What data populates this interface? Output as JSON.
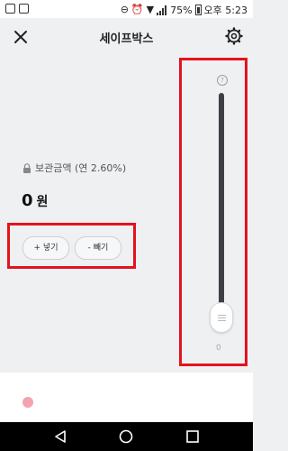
{
  "status_bar": {
    "battery_percent": "75%",
    "time": "오후 5:23"
  },
  "header": {
    "title": "세이프박스",
    "close_icon": "close-icon",
    "settings_icon": "gear-icon"
  },
  "balance": {
    "label": "보관금액 (연 2.60%)",
    "amount": "0",
    "unit": "원"
  },
  "actions": {
    "deposit_label": "+ 넣기",
    "withdraw_label": "- 빼기"
  },
  "slider": {
    "help_symbol": "?",
    "min_label": "0",
    "value_fraction": 0
  },
  "colors": {
    "accent_highlight": "#e4131c",
    "dot": "#f4a3b0",
    "track": "#3d3f44"
  }
}
